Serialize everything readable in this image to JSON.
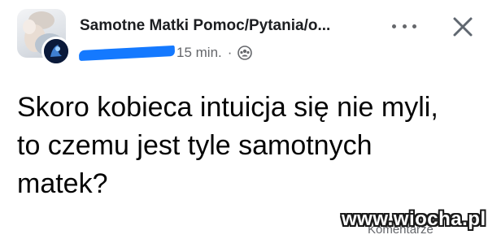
{
  "post": {
    "group_name": "Samotne Matki Pomoc/Pytania/o...",
    "time": "15 min.",
    "separator": "·",
    "audience_icon": "group-audience-icon",
    "text": "Skoro kobieca intuicja się nie myli, to czemu jest tyle samotnych matek?",
    "comments_label": "Komentarze"
  },
  "header": {
    "more_icon": "more-horizontal-icon",
    "close_icon": "close-icon"
  },
  "watermark": "www.wiocha.pl",
  "colors": {
    "accent_redaction": "#1479ff",
    "text": "#050505",
    "secondary_text": "#65676b"
  }
}
